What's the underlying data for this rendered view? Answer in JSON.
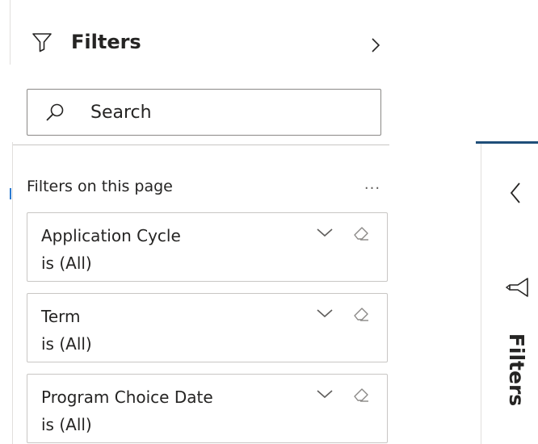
{
  "filters_pane": {
    "title": "Filters",
    "search_placeholder": "Search",
    "section_label": "Filters on this page",
    "more_label": "...",
    "cards": [
      {
        "title": "Application Cycle",
        "value": "is (All)"
      },
      {
        "title": "Term",
        "value": "is (All)"
      },
      {
        "title": "Program Choice Date",
        "value": "is (All)"
      }
    ]
  },
  "collapsed_pane": {
    "label": "Filters"
  },
  "colors": {
    "accent": "#1f4e79",
    "border": "#c8c6c4",
    "text": "#252423"
  },
  "icons": [
    "funnel-icon",
    "chevron-right-icon",
    "search-icon",
    "more-options-icon",
    "chevron-down-icon",
    "eraser-icon",
    "chevron-left-icon"
  ]
}
